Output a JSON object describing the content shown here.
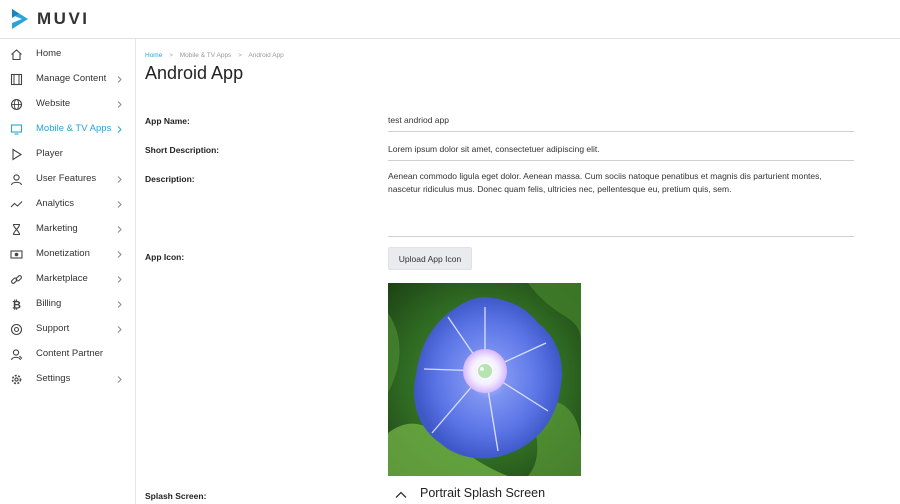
{
  "brand": {
    "name": "MUVI",
    "color": "#2aa3d8"
  },
  "colors": {
    "accent": "#2aa3d8",
    "text": "#222222",
    "muted": "#999999"
  },
  "sidebar": {
    "items": [
      {
        "label": "Home",
        "icon": "home-icon",
        "has_submenu": false,
        "active": false
      },
      {
        "label": "Manage Content",
        "icon": "film-icon",
        "has_submenu": true,
        "active": false
      },
      {
        "label": "Website",
        "icon": "globe-icon",
        "has_submenu": true,
        "active": false
      },
      {
        "label": "Mobile & TV Apps",
        "icon": "monitor-icon",
        "has_submenu": true,
        "active": true
      },
      {
        "label": "Player",
        "icon": "play-icon",
        "has_submenu": false,
        "active": false
      },
      {
        "label": "User Features",
        "icon": "user-icon",
        "has_submenu": true,
        "active": false
      },
      {
        "label": "Analytics",
        "icon": "trend-icon",
        "has_submenu": true,
        "active": false
      },
      {
        "label": "Marketing",
        "icon": "hourglass-icon",
        "has_submenu": true,
        "active": false
      },
      {
        "label": "Monetization",
        "icon": "money-icon",
        "has_submenu": true,
        "active": false
      },
      {
        "label": "Marketplace",
        "icon": "link-icon",
        "has_submenu": true,
        "active": false
      },
      {
        "label": "Billing",
        "icon": "bitcoin-icon",
        "has_submenu": true,
        "active": false
      },
      {
        "label": "Support",
        "icon": "lifebuoy-icon",
        "has_submenu": true,
        "active": false
      },
      {
        "label": "Content Partner",
        "icon": "partner-icon",
        "has_submenu": false,
        "active": false
      },
      {
        "label": "Settings",
        "icon": "gear-icon",
        "has_submenu": true,
        "active": false
      }
    ]
  },
  "breadcrumb": {
    "home": "Home",
    "section": "Mobile & TV Apps",
    "current": "Android App"
  },
  "page": {
    "title": "Android App"
  },
  "form": {
    "app_name_label": "App Name:",
    "app_name_value": "test andriod app",
    "short_desc_label": "Short Description:",
    "short_desc_value": "Lorem ipsum dolor sit amet, consectetuer adipiscing elit.",
    "desc_label": "Description:",
    "desc_value": "Aenean commodo ligula eget dolor. Aenean massa. Cum sociis natoque penatibus et magnis dis parturient montes, nascetur ridiculus mus. Donec quam felis, ultricies nec, pellentesque eu, pretium quis, sem.",
    "app_icon_label": "App Icon:",
    "upload_button": "Upload App Icon",
    "app_icon_image": "blue-flower-image",
    "splash_label": "Splash Screen:",
    "splash_section_title": "Portrait Splash Screen"
  }
}
